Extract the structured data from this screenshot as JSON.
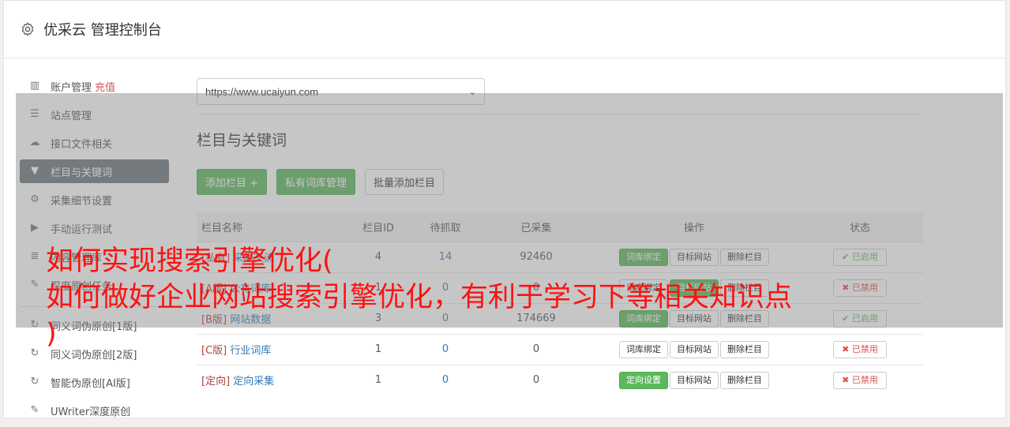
{
  "header": {
    "title": "优采云 管理控制台",
    "icon": "gear-icon"
  },
  "sidebar": {
    "items": [
      {
        "label": "账户管理",
        "extra": "充值",
        "icon": "bar-chart-icon",
        "active": false
      },
      {
        "label": "站点管理",
        "icon": "server-icon",
        "active": false
      },
      {
        "label": "接口文件相关",
        "icon": "cloud-upload-icon",
        "active": false
      },
      {
        "label": "栏目与关键词",
        "icon": "filter-icon",
        "active": true
      },
      {
        "label": "采集细节设置",
        "icon": "cogs-icon",
        "active": false
      },
      {
        "label": "手动运行测试",
        "icon": "play-circle-icon",
        "active": false
      },
      {
        "label": "内容管理库",
        "icon": "database-icon",
        "active": false
      },
      {
        "label": "深度原创任务",
        "icon": "edit-icon",
        "active": false
      }
    ],
    "items2": [
      {
        "label": "同义词伪原创[1版]",
        "icon": "refresh-icon"
      },
      {
        "label": "同义词伪原创[2版]",
        "icon": "refresh-icon"
      },
      {
        "label": "智能伪原创[AI版]",
        "icon": "refresh-icon"
      },
      {
        "label": "UWriter深度原创",
        "icon": "edit-icon"
      }
    ]
  },
  "main": {
    "site_select": "https://www.ucaiyun.com",
    "section_title": "栏目与关键词",
    "buttons": {
      "add": "添加栏目 +",
      "private_lib": "私有词库管理",
      "batch_add": "批量添加栏目"
    },
    "table": {
      "headers": [
        "栏目名称",
        "栏目ID",
        "待抓取",
        "已采集",
        "操作",
        "状态"
      ],
      "rows": [
        {
          "tag": "[私有]",
          "name": "采集交流",
          "id": "4",
          "pending": "14",
          "collected": "92460",
          "op1": "词库绑定",
          "op2": "目标网站",
          "op3": "删除栏目",
          "status": "已启用",
          "on": true,
          "op1green": true
        },
        {
          "tag": "[A版]",
          "name": "公有词库",
          "id": "1",
          "pending": "0",
          "collected": "0",
          "op1": "词库绑定",
          "op2": "目标网站",
          "op3": "删除栏目",
          "status": "已禁用",
          "on": false,
          "op2green": true
        },
        {
          "tag": "[B版]",
          "name": "网站数据",
          "id": "3",
          "pending": "0",
          "collected": "174669",
          "op1": "词库绑定",
          "op2": "目标网站",
          "op3": "删除栏目",
          "status": "已启用",
          "on": true,
          "op1green": true
        },
        {
          "tag": "[C版]",
          "name": "行业词库",
          "id": "1",
          "pending": "0",
          "collected": "0",
          "op1": "词库绑定",
          "op2": "目标网站",
          "op3": "删除栏目",
          "status": "已禁用",
          "on": false
        },
        {
          "tag": "[定向]",
          "name": "定向采集",
          "id": "1",
          "pending": "0",
          "collected": "0",
          "op1": "定向设置",
          "op2": "目标网站",
          "op3": "删除栏目",
          "status": "已禁用",
          "on": false,
          "op1green": true
        }
      ]
    }
  },
  "overlay_headline": {
    "line1": "如何实现搜索引擎优化(",
    "line2": "如何做好企业网站搜索引擎优化，有利于学习下等相关知识点",
    "line3": ")"
  },
  "colors": {
    "accent_green": "#5cb85c",
    "danger": "#d9534f",
    "headline": "#ff1111",
    "sidebar_active": "#6c757d"
  }
}
